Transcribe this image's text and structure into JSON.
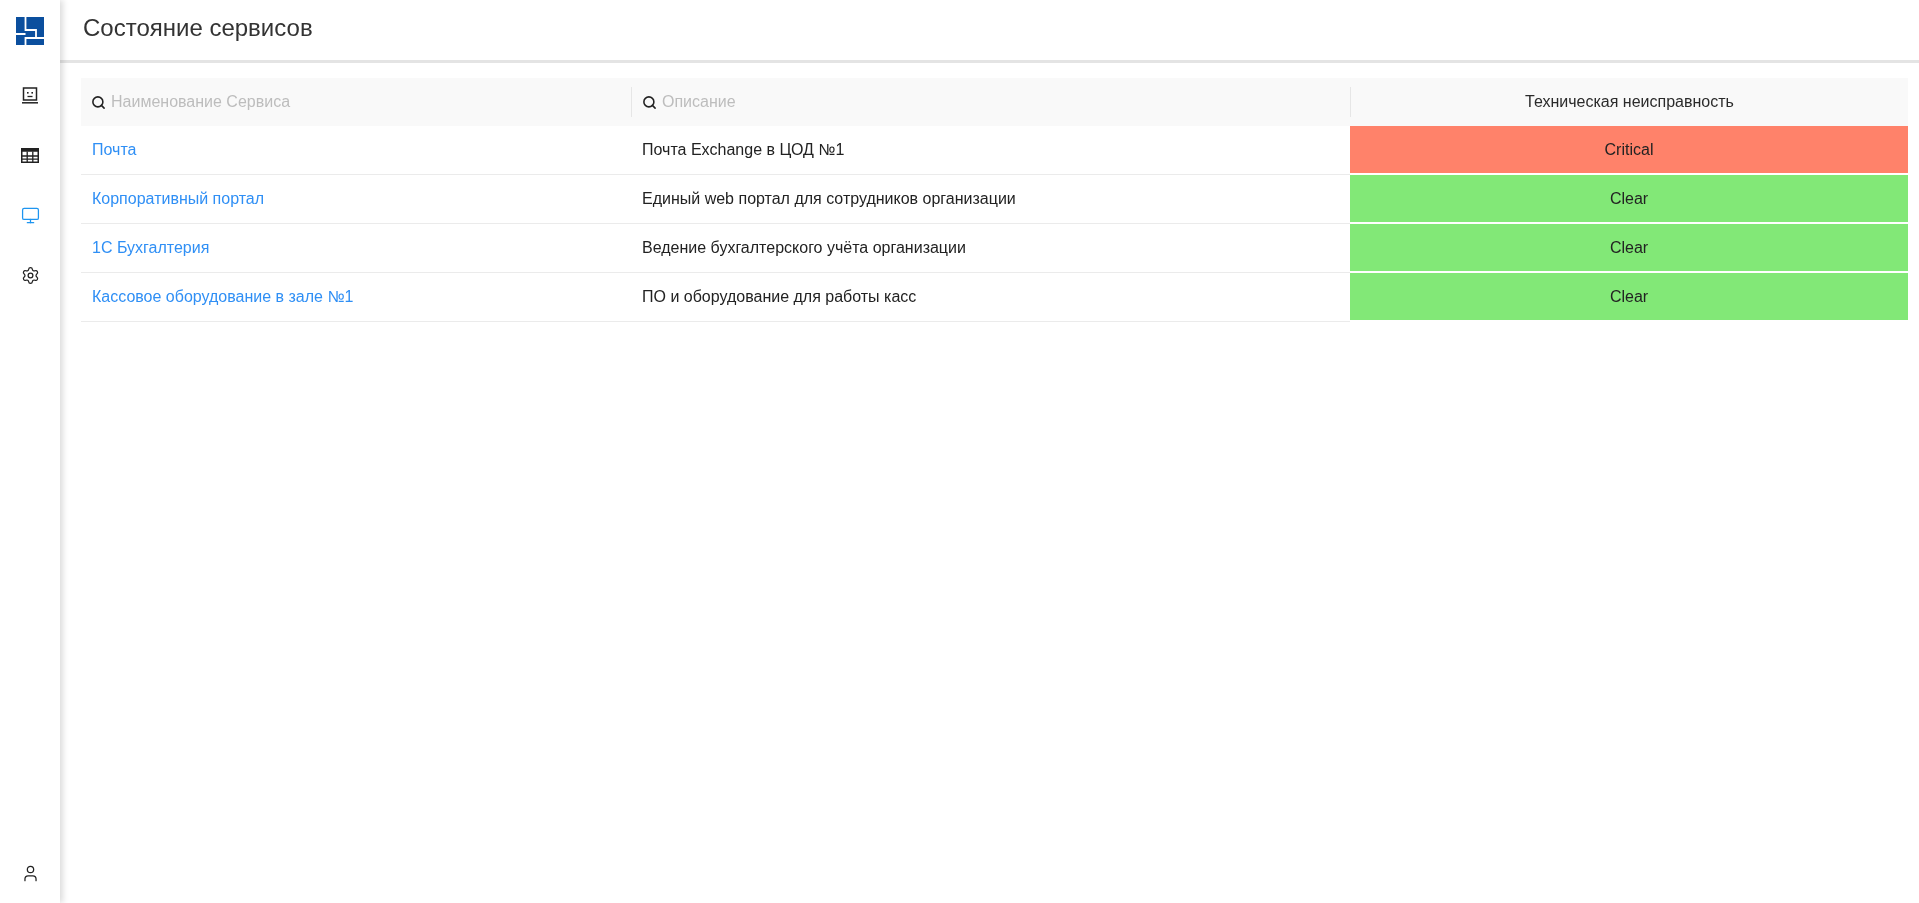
{
  "sidebar": {
    "nav_items": [
      {
        "selected": false
      },
      {
        "selected": false
      },
      {
        "selected": true
      },
      {
        "selected": false
      }
    ]
  },
  "header": {
    "title": "Состояние сервисов"
  },
  "table": {
    "columns": [
      {
        "kind": "search",
        "placeholder": "Наименование Сервиса"
      },
      {
        "kind": "search",
        "placeholder": "Описание"
      },
      {
        "kind": "label",
        "label": "Техническая неисправность"
      }
    ],
    "rows": [
      {
        "service": "Почта",
        "description": "Почта Exchange в ЦОД №1",
        "status": "Critical",
        "color": "#ff826a"
      },
      {
        "service": "Корпоративный портал",
        "description": "Единый web портал для сотрудников организации",
        "status": "Clear",
        "color": "#82e877"
      },
      {
        "service": "1С Бухгалтерия",
        "description": "Ведение бухгалтерского учёта организации",
        "status": "Clear",
        "color": "#82e877"
      },
      {
        "service": "Кассовое оборудование в зале №1",
        "description": "ПО и оборудование для работы касс",
        "status": "Clear",
        "color": "#82e877"
      }
    ]
  }
}
